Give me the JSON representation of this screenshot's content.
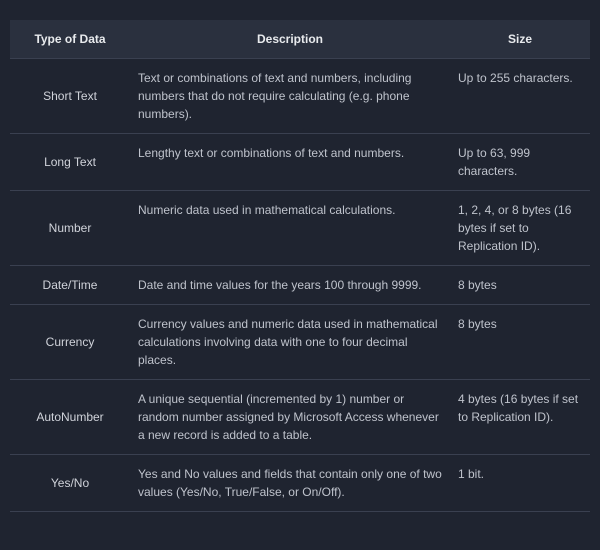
{
  "table": {
    "headers": {
      "type": "Type of Data",
      "description": "Description",
      "size": "Size"
    },
    "rows": [
      {
        "type": "Short Text",
        "description": "Text or combinations of text and numbers, including numbers that do not require calculating (e.g. phone numbers).",
        "size": "Up to 255 characters."
      },
      {
        "type": "Long Text",
        "description": "Lengthy text or combinations of text and numbers.",
        "size": "Up to 63, 999 characters."
      },
      {
        "type": "Number",
        "description": "Numeric data used in mathematical calculations.",
        "size": "1, 2, 4, or 8 bytes (16 bytes if set to Replication ID)."
      },
      {
        "type": "Date/Time",
        "description": "Date and time values for the years 100 through 9999.",
        "size": "8 bytes"
      },
      {
        "type": "Currency",
        "description": "Currency values and numeric data used in mathematical calculations involving data with one to four decimal places.",
        "size": "8 bytes"
      },
      {
        "type": "AutoNumber",
        "description": "A unique sequential (incremented by 1) number or random number assigned by Microsoft Access whenever a new record is added to a table.",
        "size": "4 bytes (16 bytes if set to Replication ID)."
      },
      {
        "type": "Yes/No",
        "description": "Yes and No values and fields that contain only one of two values (Yes/No, True/False, or On/Off).",
        "size": "1 bit."
      }
    ]
  }
}
